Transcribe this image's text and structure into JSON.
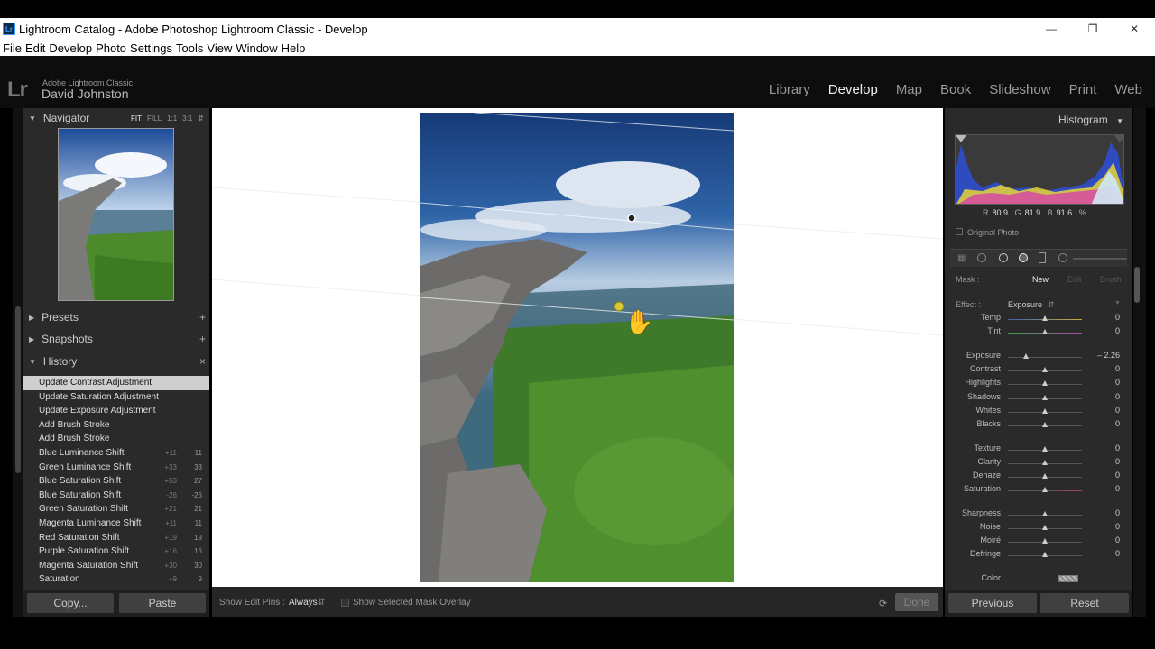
{
  "window": {
    "title": "Lightroom Catalog - Adobe Photoshop Lightroom Classic - Develop",
    "app_icon": "Lr",
    "minimize_icon": "minimize-icon",
    "restore_icon": "restore-icon",
    "close_icon": "close-icon"
  },
  "menu": [
    "File",
    "Edit",
    "Develop",
    "Photo",
    "Settings",
    "Tools",
    "View",
    "Window",
    "Help"
  ],
  "identity": {
    "logo": "Lr",
    "app_name": "Adobe Lightroom Classic",
    "user": "David Johnston"
  },
  "modules": [
    {
      "label": "Library",
      "active": false
    },
    {
      "label": "Develop",
      "active": true
    },
    {
      "label": "Map",
      "active": false
    },
    {
      "label": "Book",
      "active": false
    },
    {
      "label": "Slideshow",
      "active": false
    },
    {
      "label": "Print",
      "active": false
    },
    {
      "label": "Web",
      "active": false
    }
  ],
  "left": {
    "navigator": {
      "title": "Navigator",
      "options": [
        "FIT",
        "FILL",
        "1:1",
        "3:1"
      ],
      "active_option": "FIT"
    },
    "presets": "Presets",
    "snapshots": "Snapshots",
    "history": {
      "title": "History",
      "items": [
        {
          "label": "Update Contrast Adjustment",
          "a": "",
          "b": ""
        },
        {
          "label": "Update Saturation Adjustment",
          "a": "",
          "b": ""
        },
        {
          "label": "Update Exposure Adjustment",
          "a": "",
          "b": ""
        },
        {
          "label": "Add Brush Stroke",
          "a": "",
          "b": ""
        },
        {
          "label": "Add Brush Stroke",
          "a": "",
          "b": ""
        },
        {
          "label": "Blue Luminance Shift",
          "a": "+11",
          "b": "11"
        },
        {
          "label": "Green Luminance Shift",
          "a": "+33",
          "b": "33"
        },
        {
          "label": "Blue Saturation Shift",
          "a": "+53",
          "b": "27"
        },
        {
          "label": "Blue Saturation Shift",
          "a": "-26",
          "b": "-26"
        },
        {
          "label": "Green Saturation Shift",
          "a": "+21",
          "b": "21"
        },
        {
          "label": "Magenta Luminance Shift",
          "a": "+11",
          "b": "11"
        },
        {
          "label": "Red Saturation Shift",
          "a": "+19",
          "b": "19"
        },
        {
          "label": "Purple Saturation Shift",
          "a": "+16",
          "b": "16"
        },
        {
          "label": "Magenta Saturation Shift",
          "a": "+30",
          "b": "30"
        },
        {
          "label": "Saturation",
          "a": "+9",
          "b": "9"
        }
      ]
    },
    "copy": "Copy...",
    "paste": "Paste"
  },
  "toolbar": {
    "show_pins_label": "Show Edit Pins :",
    "show_pins_value": "Always",
    "overlay_label": "Show Selected Mask Overlay",
    "done": "Done"
  },
  "right": {
    "histogram": "Histogram",
    "rgb": {
      "r_label": "R",
      "r": "80.9",
      "g_label": "G",
      "g": "81.9",
      "b_label": "B",
      "b": "91.6",
      "unit": "%"
    },
    "original_photo": "Original Photo",
    "mask": {
      "label": "Mask :",
      "new": "New",
      "edit": "Edit",
      "brush": "Brush"
    },
    "effect": {
      "label": "Effect :",
      "value": "Exposure"
    },
    "sliders": [
      {
        "label": "Temp",
        "value": "0",
        "pos": 0.5
      },
      {
        "label": "Tint",
        "value": "0",
        "pos": 0.5
      },
      {
        "label": "Exposure",
        "value": "– 2.26",
        "pos": 0.24
      },
      {
        "label": "Contrast",
        "value": "0",
        "pos": 0.5
      },
      {
        "label": "Highlights",
        "value": "0",
        "pos": 0.5
      },
      {
        "label": "Shadows",
        "value": "0",
        "pos": 0.5
      },
      {
        "label": "Whites",
        "value": "0",
        "pos": 0.5
      },
      {
        "label": "Blacks",
        "value": "0",
        "pos": 0.5
      },
      {
        "label": "Texture",
        "value": "0",
        "pos": 0.5
      },
      {
        "label": "Clarity",
        "value": "0",
        "pos": 0.5
      },
      {
        "label": "Dehaze",
        "value": "0",
        "pos": 0.5
      },
      {
        "label": "Saturation",
        "value": "0",
        "pos": 0.5
      },
      {
        "label": "Sharpness",
        "value": "0",
        "pos": 0.5
      },
      {
        "label": "Noise",
        "value": "0",
        "pos": 0.5
      },
      {
        "label": "Moiré",
        "value": "0",
        "pos": 0.5
      },
      {
        "label": "Defringe",
        "value": "0",
        "pos": 0.5
      }
    ],
    "color_label": "Color",
    "previous": "Previous",
    "reset": "Reset"
  }
}
